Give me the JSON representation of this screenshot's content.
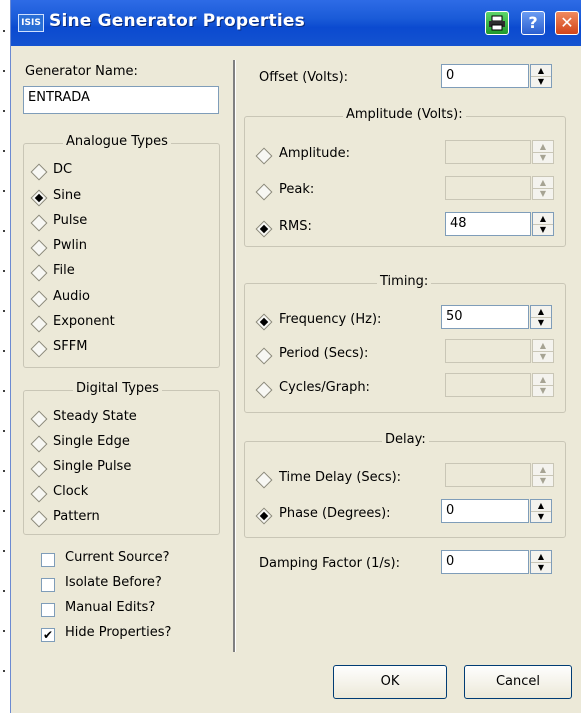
{
  "window": {
    "title": "Sine Generator Properties",
    "app_icon": "ISIS"
  },
  "titlebar_buttons": {
    "print_icon": "printer-icon",
    "help": "?",
    "close": "✕"
  },
  "generator": {
    "name_label": "Generator Name:",
    "name_value": "ENTRADA"
  },
  "analogue": {
    "title": "Analogue Types",
    "items": [
      {
        "label": "DC",
        "selected": false
      },
      {
        "label": "Sine",
        "selected": true
      },
      {
        "label": "Pulse",
        "selected": false
      },
      {
        "label": "Pwlin",
        "selected": false
      },
      {
        "label": "File",
        "selected": false
      },
      {
        "label": "Audio",
        "selected": false
      },
      {
        "label": "Exponent",
        "selected": false
      },
      {
        "label": "SFFM",
        "selected": false
      }
    ]
  },
  "digital": {
    "title": "Digital Types",
    "items": [
      {
        "label": "Steady State"
      },
      {
        "label": "Single Edge"
      },
      {
        "label": "Single Pulse"
      },
      {
        "label": "Clock"
      },
      {
        "label": "Pattern"
      }
    ]
  },
  "checkboxes": {
    "current_source": {
      "label": "Current Source?",
      "checked": false
    },
    "isolate_before": {
      "label": "Isolate Before?",
      "checked": false
    },
    "manual_edits": {
      "label": "Manual Edits?",
      "checked": false
    },
    "hide_properties": {
      "label": "Hide Properties?",
      "checked": true,
      "mark": "✔"
    }
  },
  "offset": {
    "label": "Offset (Volts):",
    "value": "0"
  },
  "amplitude": {
    "title": "Amplitude (Volts):",
    "amplitude_label": "Amplitude:",
    "amplitude_value": "",
    "peak_label": "Peak:",
    "peak_value": "",
    "rms_label": "RMS:",
    "rms_value": "48"
  },
  "timing": {
    "title": "Timing:",
    "frequency_label": "Frequency (Hz):",
    "frequency_value": "50",
    "period_label": "Period (Secs):",
    "period_value": "",
    "cycles_label": "Cycles/Graph:",
    "cycles_value": ""
  },
  "delay": {
    "title": "Delay:",
    "time_delay_label": "Time Delay (Secs):",
    "time_delay_value": "",
    "phase_label": "Phase (Degrees):",
    "phase_value": "0"
  },
  "damping": {
    "label": "Damping Factor (1/s):",
    "value": "0"
  },
  "buttons": {
    "ok": "OK",
    "cancel": "Cancel"
  },
  "spinner": {
    "up": "▲",
    "down": "▼"
  }
}
